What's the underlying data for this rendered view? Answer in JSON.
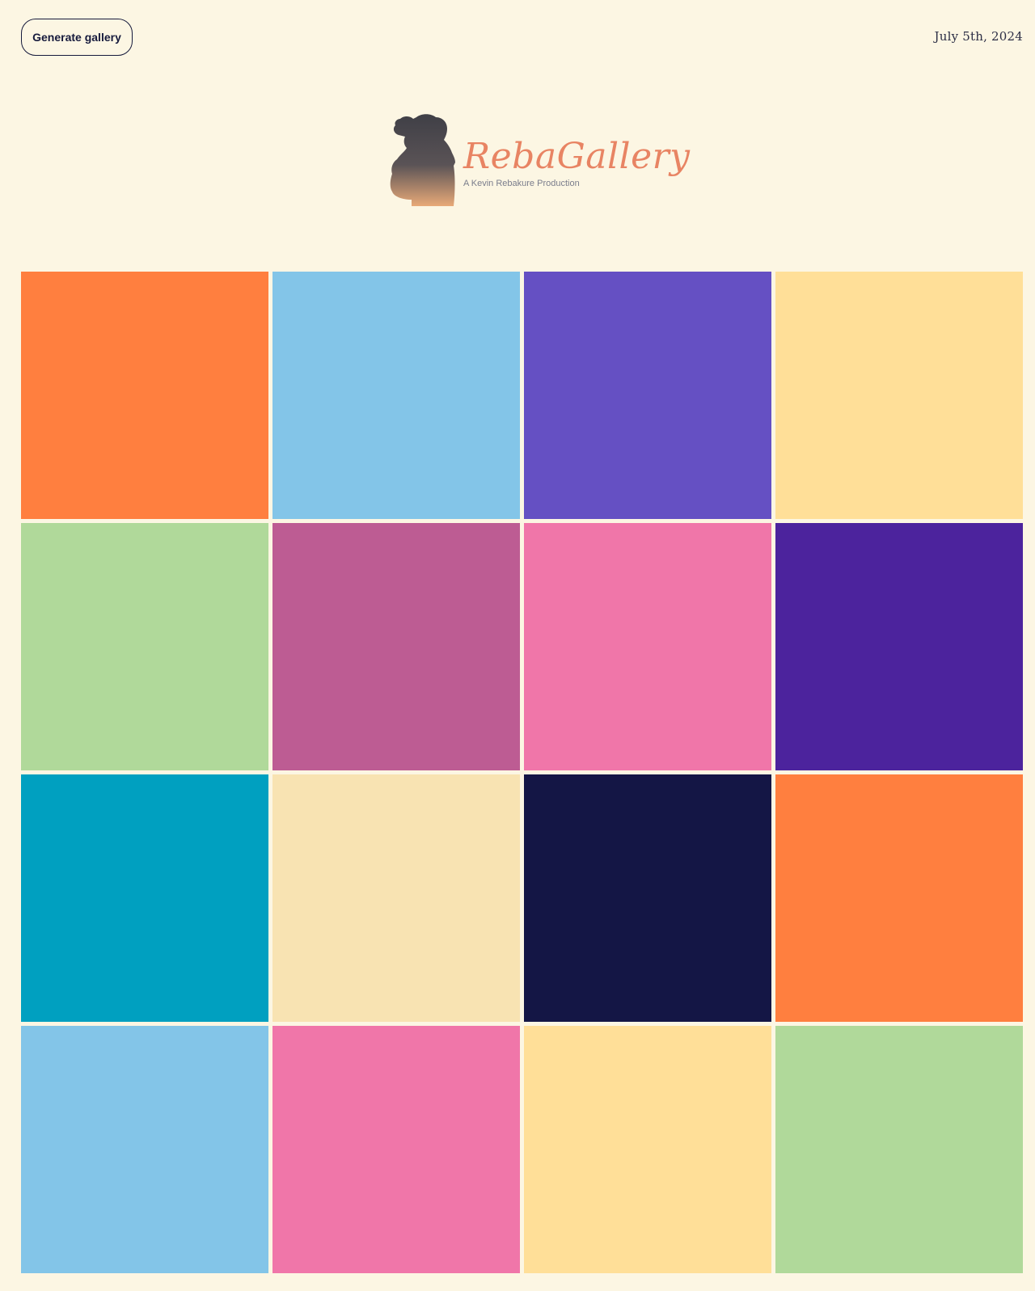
{
  "header": {
    "generate_button_label": "Generate gallery",
    "date": "July 5th, 2024"
  },
  "logo": {
    "title": "RebaGallery",
    "tagline": "A Kevin Rebakure Production",
    "icon": "photographer-silhouette-icon",
    "colors": {
      "title": "#e88463",
      "silhouette_top": "#3f3f46",
      "silhouette_bottom": "#e8a978"
    }
  },
  "gallery": {
    "tiles": [
      {
        "color": "#ff7f3f"
      },
      {
        "color": "#83c5e8"
      },
      {
        "color": "#6550c3"
      },
      {
        "color": "#ffdf98"
      },
      {
        "color": "#b0d99a"
      },
      {
        "color": "#bd5c93"
      },
      {
        "color": "#f076a9"
      },
      {
        "color": "#4c239d"
      },
      {
        "color": "#00a0c0"
      },
      {
        "color": "#f8e3b2"
      },
      {
        "color": "#141645"
      },
      {
        "color": "#ff7f3f"
      },
      {
        "color": "#83c5e8"
      },
      {
        "color": "#f076a9"
      },
      {
        "color": "#ffdf98"
      },
      {
        "color": "#b0d99a"
      }
    ]
  },
  "theme": {
    "background": "#fcf6e3",
    "text": "#161a3c"
  }
}
